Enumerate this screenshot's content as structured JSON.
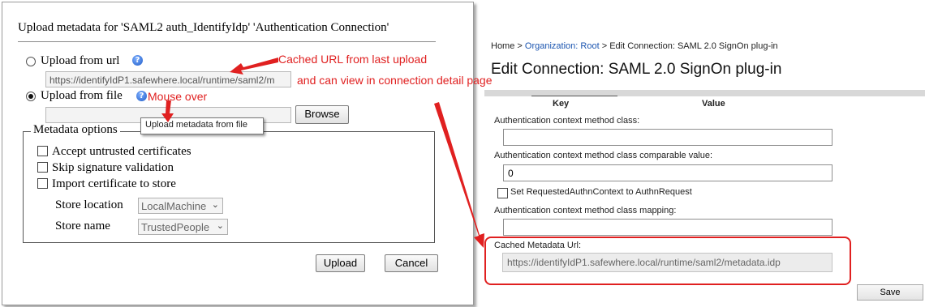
{
  "dialog": {
    "title": "Upload metadata for 'SAML2 auth_IdentifyIdp' 'Authentication Connection'",
    "upload_from_url_label": "Upload from url",
    "url_value": "https://identifyIdP1.safewhere.local/runtime/saml2/m",
    "upload_from_file_label": "Upload from file",
    "browse_label": "Browse",
    "tooltip_text": "Upload metadata from file",
    "metadata_options_legend": "Metadata options",
    "accept_untrusted_label": "Accept untrusted certificates",
    "skip_signature_label": "Skip signature validation",
    "import_certificate_label": "Import certificate to store",
    "store_location_label": "Store location",
    "store_location_value": "LocalMachine",
    "store_name_label": "Store name",
    "store_name_value": "TrustedPeople",
    "upload_button": "Upload",
    "cancel_button": "Cancel",
    "help_glyph": "?",
    "selected_option": "upload_from_file"
  },
  "annotations": {
    "cached_url": "Cached URL from last upload",
    "view_detail": "and can view in connection detail page",
    "mouse_over": "Mouse over",
    "color": "#e02020"
  },
  "connection": {
    "breadcrumb": {
      "home": "Home",
      "sep": ">",
      "org": "Organization: Root",
      "current": "Edit Connection: SAML 2.0 SignOn plug-in"
    },
    "title": "Edit Connection: SAML 2.0 SignOn plug-in",
    "col_key": "Key",
    "col_value": "Value",
    "auth_ctx_class_label": "Authentication context method class:",
    "auth_ctx_class_value": "",
    "auth_ctx_comparable_label": "Authentication context method class comparable value:",
    "auth_ctx_comparable_value": "0",
    "set_requested_label": "Set RequestedAuthnContext to AuthnRequest",
    "auth_ctx_mapping_label": "Authentication context method class mapping:",
    "auth_ctx_mapping_value": "",
    "cached_metadata_label": "Cached Metadata Url:",
    "cached_metadata_value": "https://identifyIdP1.safewhere.local/runtime/saml2/metadata.idp",
    "save_button": "Save"
  }
}
